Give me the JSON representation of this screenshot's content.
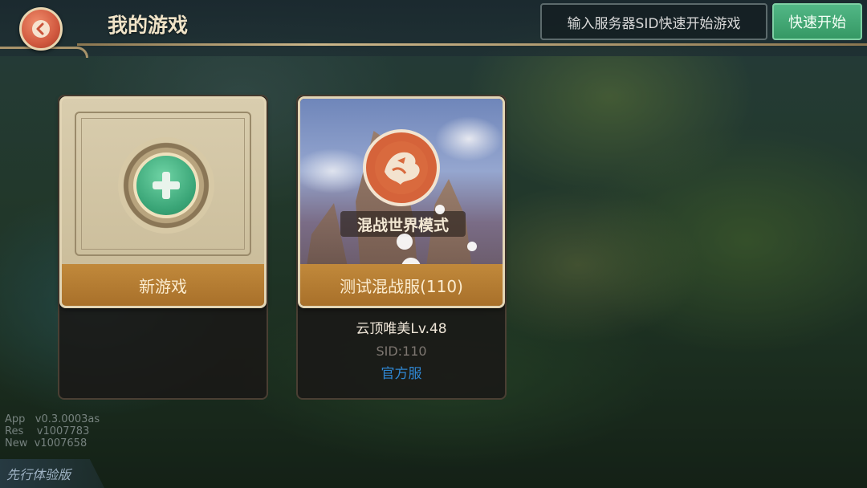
{
  "header": {
    "title": "我的游戏",
    "sid_placeholder": "输入服务器SID快速开始游戏",
    "quick_start_label": "快速开始"
  },
  "cards": {
    "new_game": {
      "label": "新游戏"
    },
    "server": {
      "mode_label": "混战世界模式",
      "server_name": "测试混战服(110)",
      "character": "云顶唯美Lv.48",
      "sid": "SID:110",
      "server_type": "官方服"
    }
  },
  "version": {
    "app": "App   v0.3.0003as",
    "res": "Res    v1007783",
    "new": "New  v1007658"
  },
  "badge": "先行体验版",
  "colors": {
    "accent_green": "#3aa577",
    "card_footer": "#b57c33",
    "back_button": "#d1593f",
    "link_blue": "#2f86d1"
  },
  "icons": {
    "back": "back-arrow-icon",
    "add": "plus-icon",
    "emblem": "dragon-emblem-icon"
  }
}
